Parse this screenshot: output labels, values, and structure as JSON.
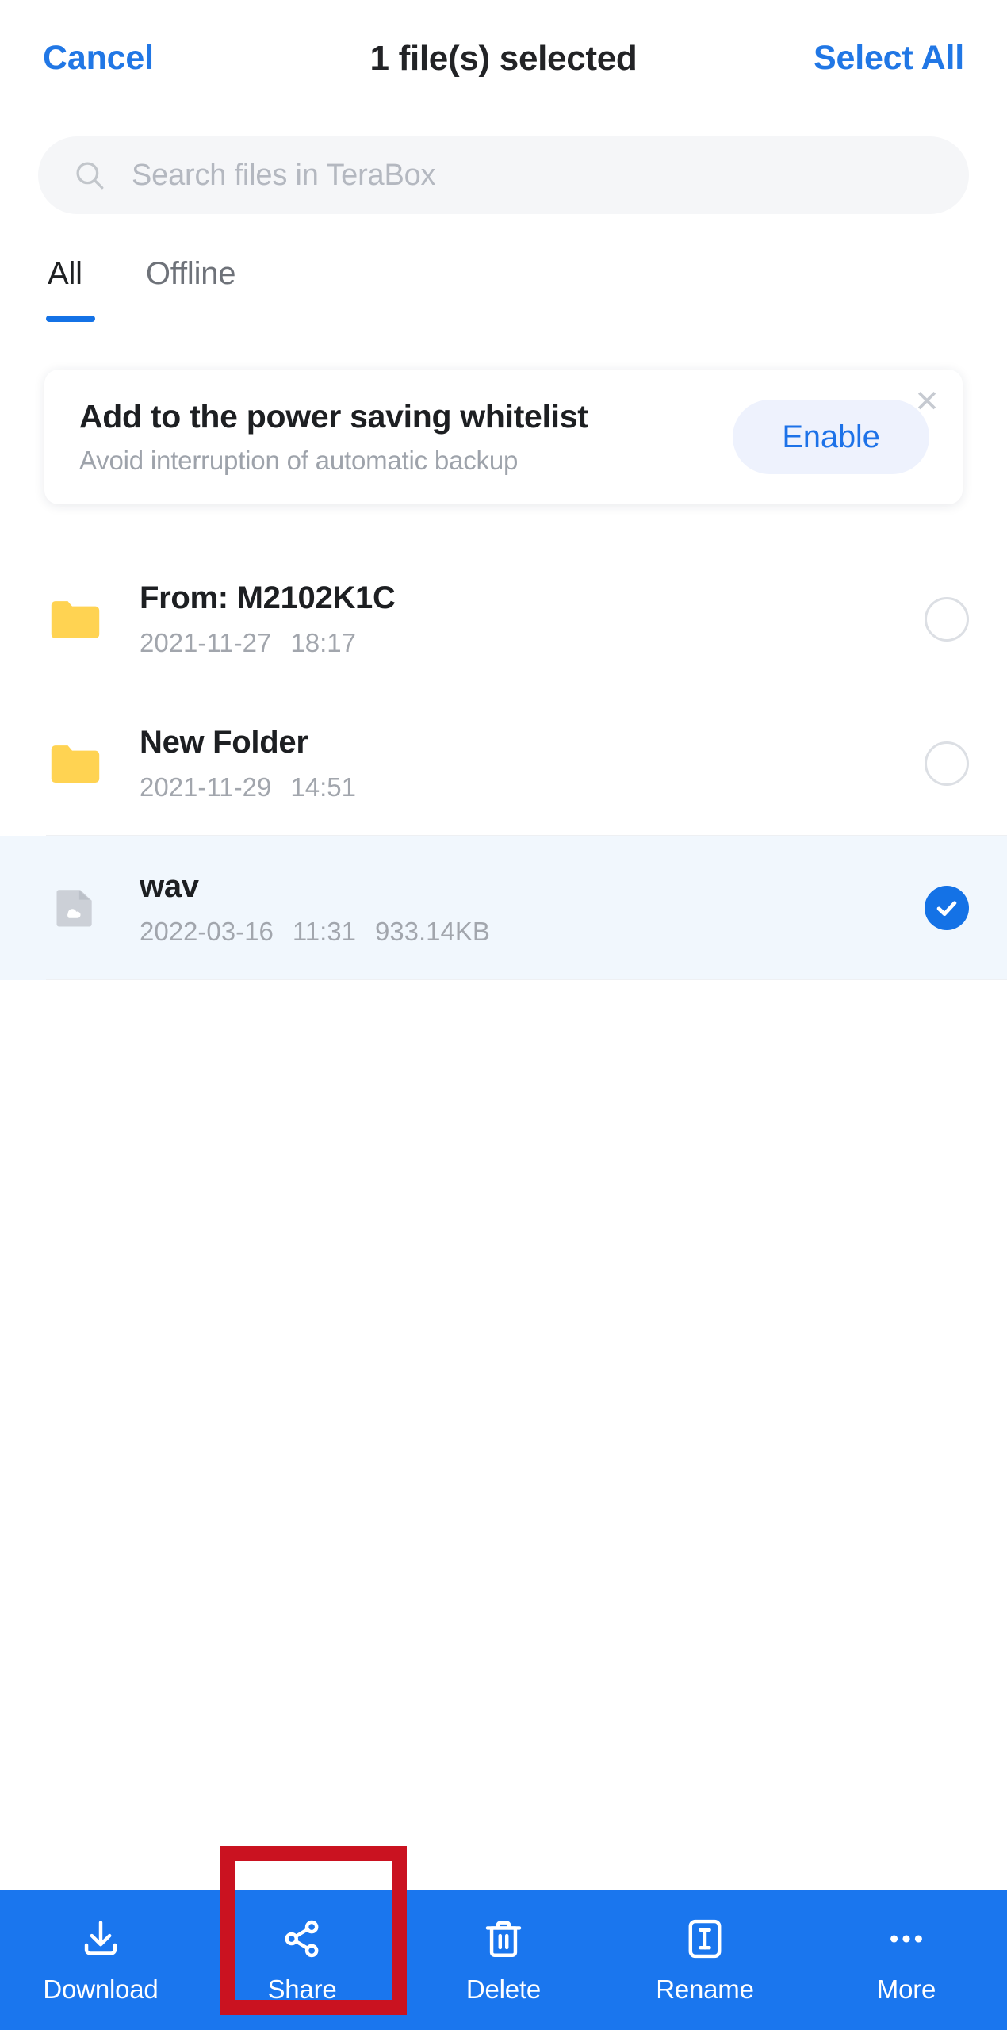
{
  "topbar": {
    "cancel_label": "Cancel",
    "title": "1 file(s) selected",
    "select_all_label": "Select All"
  },
  "search": {
    "placeholder": "Search files in TeraBox",
    "icon": "search-icon"
  },
  "tabs": [
    {
      "label": "All",
      "active": true
    },
    {
      "label": "Offline",
      "active": false
    }
  ],
  "banner": {
    "title": "Add to the power saving whitelist",
    "subtitle": "Avoid interruption of automatic backup",
    "action_label": "Enable",
    "close_icon": "close-icon",
    "close_glyph": "✕"
  },
  "files": [
    {
      "name": "From: M2102K1C",
      "date": "2021-11-27",
      "time": "18:17",
      "size": "",
      "type": "folder",
      "icon": "folder-icon",
      "selected": false
    },
    {
      "name": "New Folder",
      "date": "2021-11-29",
      "time": "14:51",
      "size": "",
      "type": "folder",
      "icon": "folder-icon",
      "selected": false
    },
    {
      "name": "wav",
      "date": "2022-03-16",
      "time": "11:31",
      "size": "933.14KB",
      "type": "file",
      "icon": "cloud-file-icon",
      "selected": true
    }
  ],
  "bottombar": {
    "items": [
      {
        "label": "Download",
        "icon": "download-icon"
      },
      {
        "label": "Share",
        "icon": "share-icon"
      },
      {
        "label": "Delete",
        "icon": "trash-icon"
      },
      {
        "label": "Rename",
        "icon": "rename-icon"
      },
      {
        "label": "More",
        "icon": "more-dots-icon"
      }
    ]
  },
  "annotation": {
    "highlight_target": "Share",
    "highlight_color": "#ca1220"
  },
  "colors": {
    "accent_blue": "#1472e6",
    "link_blue": "#2177e5",
    "bottom_bar_blue": "#1a76ee",
    "folder_yellow": "#ffd352",
    "selected_row_bg": "#f1f7fd",
    "search_bg": "#f5f6f8",
    "muted_text": "#a2a6ad"
  }
}
